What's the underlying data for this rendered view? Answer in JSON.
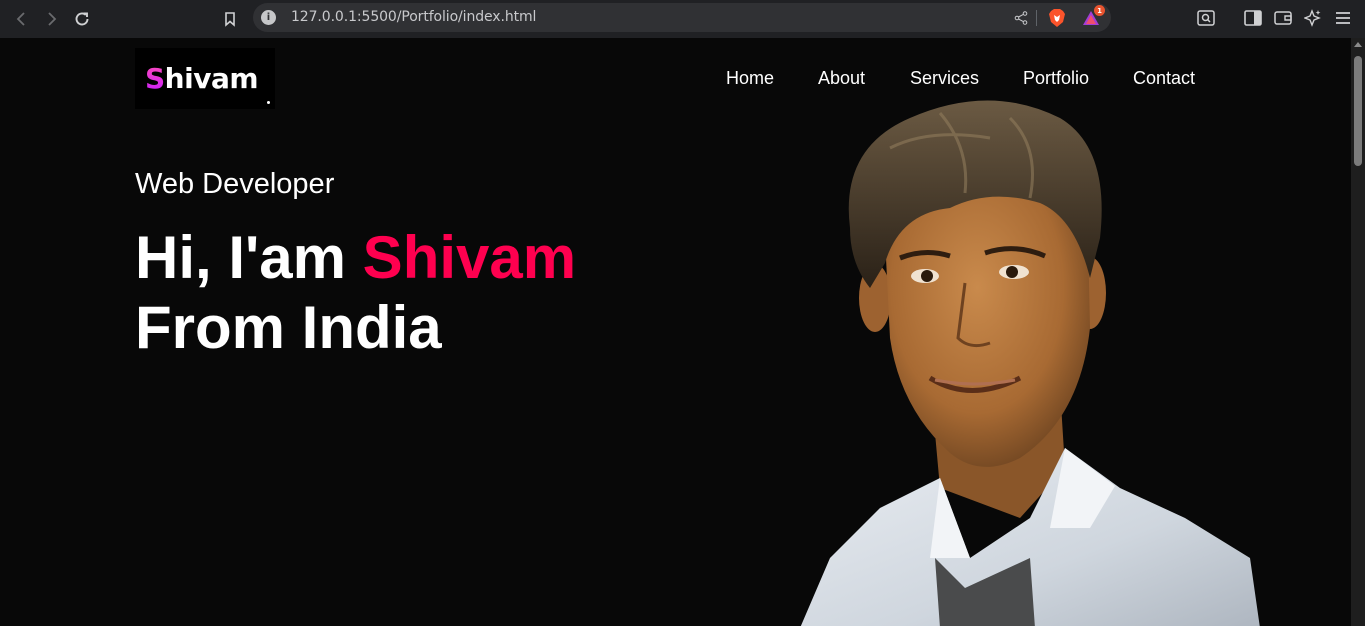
{
  "browser": {
    "url": "127.0.0.1:5500/Portfolio/index.html",
    "info_icon": "i",
    "badge_count": "1"
  },
  "page": {
    "logo": {
      "first_letter": "S",
      "rest": "hivam"
    },
    "nav": [
      {
        "label": "Home"
      },
      {
        "label": "About"
      },
      {
        "label": "Services"
      },
      {
        "label": "Portfolio"
      },
      {
        "label": "Contact"
      }
    ],
    "hero": {
      "subtitle": "Web Developer",
      "greeting": "Hi, I'am ",
      "name": "Shivam",
      "line2": "From India"
    }
  },
  "colors": {
    "accent": "#ff004f",
    "background": "#080808",
    "chrome": "#202124"
  }
}
